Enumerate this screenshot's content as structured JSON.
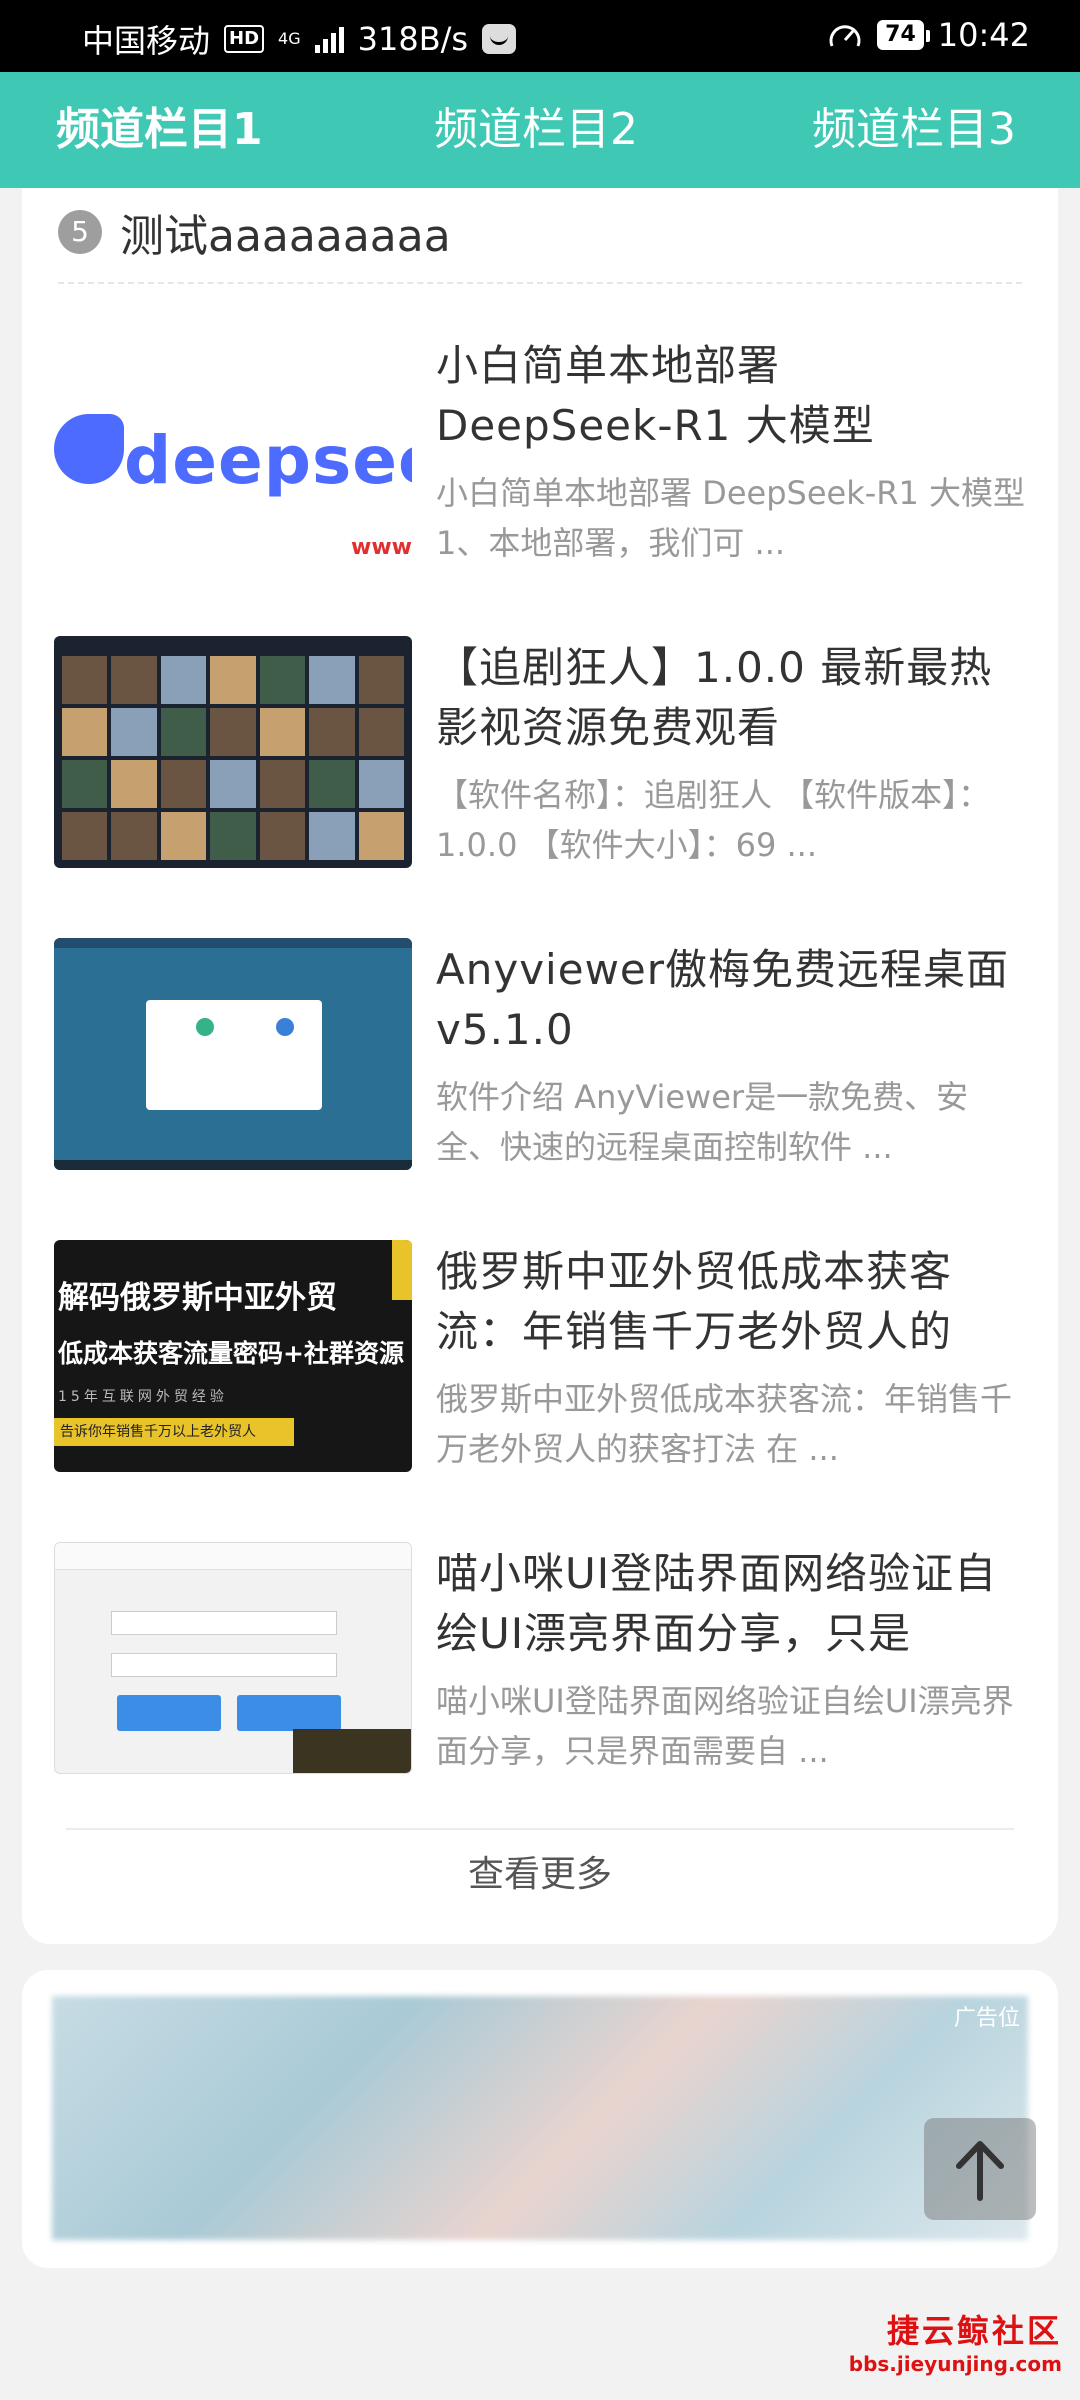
{
  "status_bar": {
    "carrier": "中国移动",
    "hd": "HD",
    "network": "4G",
    "speed": "318B/s",
    "battery": "74",
    "time": "10:42"
  },
  "tabs": [
    {
      "label": "频道栏目1",
      "active": true
    },
    {
      "label": "频道栏目2",
      "active": false
    },
    {
      "label": "频道栏目3",
      "active": false
    }
  ],
  "ranked_item": {
    "rank": "5",
    "title": "测试aaaaaaaaa"
  },
  "articles": [
    {
      "thumb_text": "deepsee",
      "thumb_mark": "www",
      "title": "小白简单本地部署 DeepSeek-R1 大模型",
      "desc": "小白简单本地部署 DeepSeek-R1 大模型 1、本地部署，我们可 ..."
    },
    {
      "title": "【追剧狂人】1.0.0 最新最热影视资源免费观看",
      "desc": "【软件名称】：追剧狂人 【软件版本】：1.0.0 【软件大小】：69 ..."
    },
    {
      "title": "Anyviewer傲梅免费远程桌面v5.1.0",
      "desc": "软件介绍 AnyViewer是一款免费、安全、快速的远程桌面控制软件 ..."
    },
    {
      "thumb_line1": "解码俄罗斯中亚外贸",
      "thumb_line2": "低成本获客流量密码+社群资源",
      "thumb_line3": "15年互联网外贸经验",
      "thumb_banner": "告诉你年销售千万以上老外贸人",
      "title": "俄罗斯中亚外贸低成本获客流：年销售千万老外贸人的",
      "desc": "俄罗斯中亚外贸低成本获客流：年销售千万老外贸人的获客打法 在 ..."
    },
    {
      "title": "喵小咪UI登陆界面网络验证自绘UI漂亮界面分享，只是",
      "desc": "喵小咪UI登陆界面网络验证自绘UI漂亮界面分享，只是界面需要自 ..."
    }
  ],
  "more_label": "查看更多",
  "ad_label": "广告位",
  "watermark": {
    "name": "捷云鲸社区",
    "url": "bbs.jieyunjing.com"
  },
  "colors": {
    "accent": "#3fc8b3",
    "watermark": "#dd1111"
  },
  "icons": [
    "signal-icon",
    "app-notification-icon",
    "speed-dial-icon",
    "battery-icon",
    "arrow-up-icon"
  ]
}
